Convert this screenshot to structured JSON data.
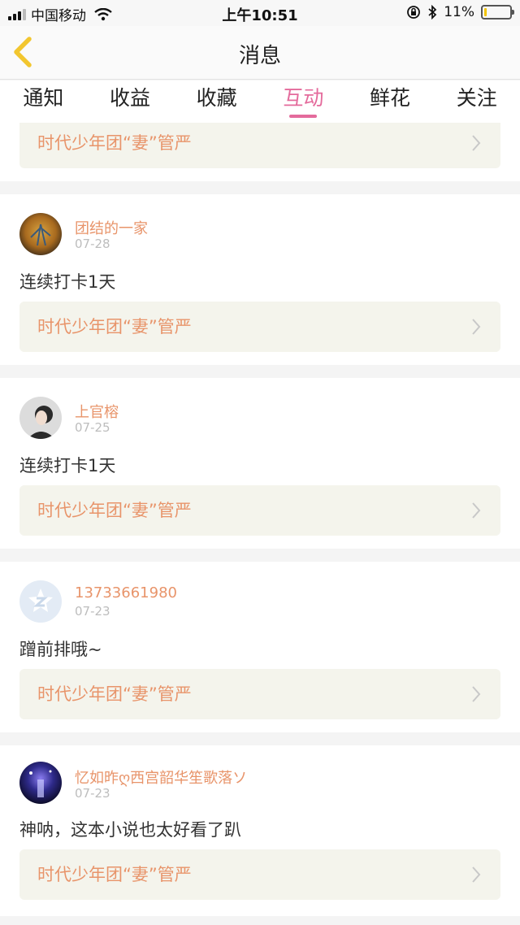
{
  "status_bar": {
    "carrier": "中国移动",
    "time": "上午10:51",
    "battery": "11%",
    "battery_level": 0.11
  },
  "header": {
    "title": "消息"
  },
  "tabs": [
    {
      "label": "通知",
      "active": false
    },
    {
      "label": "收益",
      "active": false
    },
    {
      "label": "收藏",
      "active": false
    },
    {
      "label": "互动",
      "active": true
    },
    {
      "label": "鲜花",
      "active": false
    },
    {
      "label": "关注",
      "active": false
    }
  ],
  "partial_card": {
    "ref_title": "时代少年团“妻”管严"
  },
  "messages": [
    {
      "username": "团结的一家",
      "date": "07-28",
      "content": "连续打卡1天",
      "ref_title": "时代少年团“妻”管严",
      "avatar_icon": "avatar-photo"
    },
    {
      "username": "上官榕",
      "date": "07-25",
      "content": "连续打卡1天",
      "ref_title": "时代少年团“妻”管严",
      "avatar_icon": "avatar-photo"
    },
    {
      "username": "13733661980",
      "date": "07-23",
      "content": "蹭前排哦~",
      "ref_title": "时代少年团“妻”管严",
      "avatar_icon": "qq-default-avatar-icon"
    },
    {
      "username": "忆如昨ღ西宫韶华笙歌落ソ",
      "date": "07-23",
      "content": "神呐，这本小说也太好看了趴",
      "ref_title": "时代少年团“妻”管严",
      "avatar_icon": "avatar-photo"
    }
  ],
  "colors": {
    "accent": "#e46b9c",
    "link": "#e8946a",
    "ref_bg": "#f4f4ec",
    "back_arrow": "#f2c62f"
  }
}
